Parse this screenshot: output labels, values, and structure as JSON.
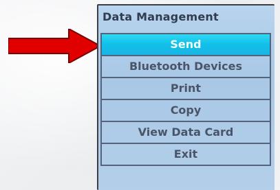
{
  "menu": {
    "title": "Data Management",
    "items": [
      {
        "label": "Send",
        "selected": true
      },
      {
        "label": "Bluetooth Devices",
        "selected": false
      },
      {
        "label": "Print",
        "selected": false
      },
      {
        "label": "Copy",
        "selected": false
      },
      {
        "label": "View Data Card",
        "selected": false
      },
      {
        "label": "Exit",
        "selected": false
      }
    ]
  },
  "pointer": {
    "icon": "red-arrow-icon",
    "color": "#e00000"
  },
  "colors": {
    "selected_background": "#14c2ea",
    "screen_background": "#b2cee8",
    "text": "#4a5568"
  }
}
